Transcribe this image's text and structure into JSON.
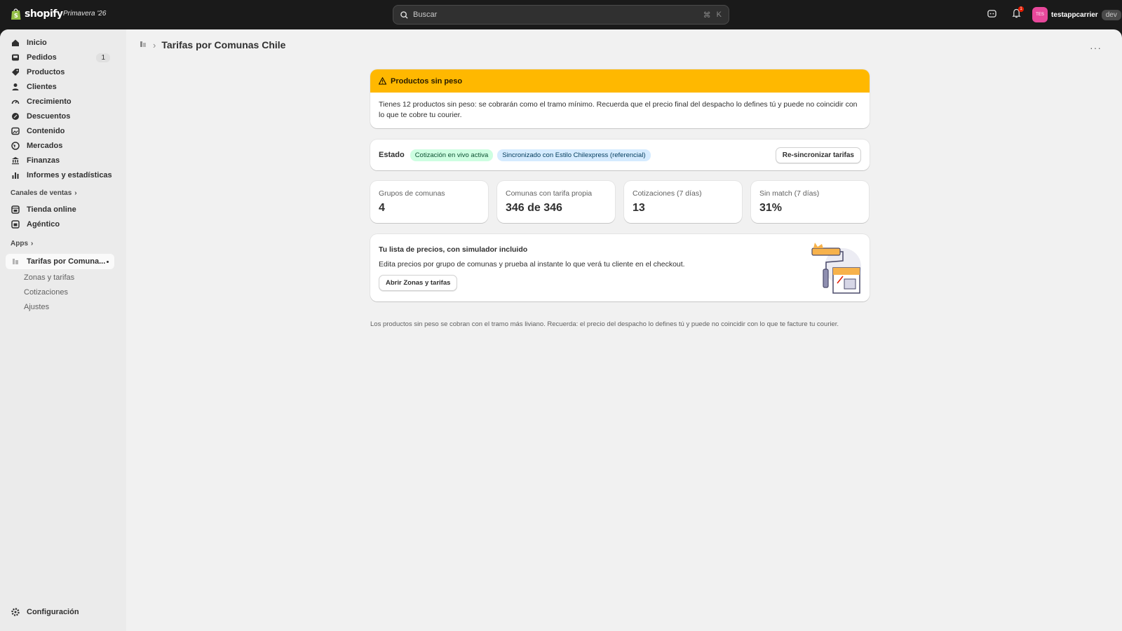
{
  "topbar": {
    "brand": "shopify",
    "edition": "Primavera '26",
    "search_placeholder": "Buscar",
    "shortcut_cmd": "⌘",
    "shortcut_key": "K",
    "notification_count": "1",
    "avatar_initials": "TES",
    "username": "testappcarrier",
    "env_tag": "dev"
  },
  "sidebar": {
    "items": [
      {
        "label": "Inicio",
        "icon": "home-icon"
      },
      {
        "label": "Pedidos",
        "icon": "inbox-icon",
        "badge": "1"
      },
      {
        "label": "Productos",
        "icon": "tag-icon"
      },
      {
        "label": "Clientes",
        "icon": "person-icon"
      },
      {
        "label": "Crecimiento",
        "icon": "gauge-icon"
      },
      {
        "label": "Descuentos",
        "icon": "discount-icon"
      },
      {
        "label": "Contenido",
        "icon": "content-icon"
      },
      {
        "label": "Mercados",
        "icon": "globe-icon"
      },
      {
        "label": "Finanzas",
        "icon": "bank-icon"
      },
      {
        "label": "Informes y estadísticas",
        "icon": "chart-icon"
      }
    ],
    "sales_channels_label": "Canales de ventas",
    "channels": [
      {
        "label": "Tienda online",
        "icon": "store-icon"
      },
      {
        "label": "Agéntico",
        "icon": "agent-icon"
      }
    ],
    "apps_label": "Apps",
    "app_active": "Tarifas por Comuna...",
    "app_subitems": [
      "Zonas y tarifas",
      "Cotizaciones",
      "Ajustes"
    ],
    "settings_label": "Configuración"
  },
  "page": {
    "title": "Tarifas por Comunas Chile",
    "banner": {
      "title": "Productos sin peso",
      "body": "Tienes 12 productos sin peso: se cobrarán como el tramo mínimo. Recuerda que el precio final del despacho lo defines tú y puede no coincidir con lo que te cobre tu courier."
    },
    "status": {
      "label": "Estado",
      "pill_live": "Cotización en vivo activa",
      "pill_sync": "Sincronizado con Estilo Chilexpress (referencial)",
      "resync_button": "Re-sincronizar tarifas"
    },
    "stats": [
      {
        "label": "Grupos de comunas",
        "value": "4"
      },
      {
        "label": "Comunas con tarifa propia",
        "value": "346 de 346"
      },
      {
        "label": "Cotizaciones (7 días)",
        "value": "13"
      },
      {
        "label": "Sin match (7 días)",
        "value": "31%"
      }
    ],
    "promo": {
      "title": "Tu lista de precios, con simulador incluido",
      "desc": "Edita precios por grupo de comunas y prueba al instante lo que verá tu cliente en el checkout.",
      "button": "Abrir Zonas y tarifas"
    },
    "footnote": "Los productos sin peso se cobran con el tramo más liviano. Recuerda: el precio del despacho lo defines tú y puede no coincidir con lo que te facture tu courier."
  },
  "colors": {
    "banner": "#ffb800",
    "pill_green": "#cdfee1",
    "pill_blue": "#d5ebff",
    "avatar": "#e8489b"
  }
}
